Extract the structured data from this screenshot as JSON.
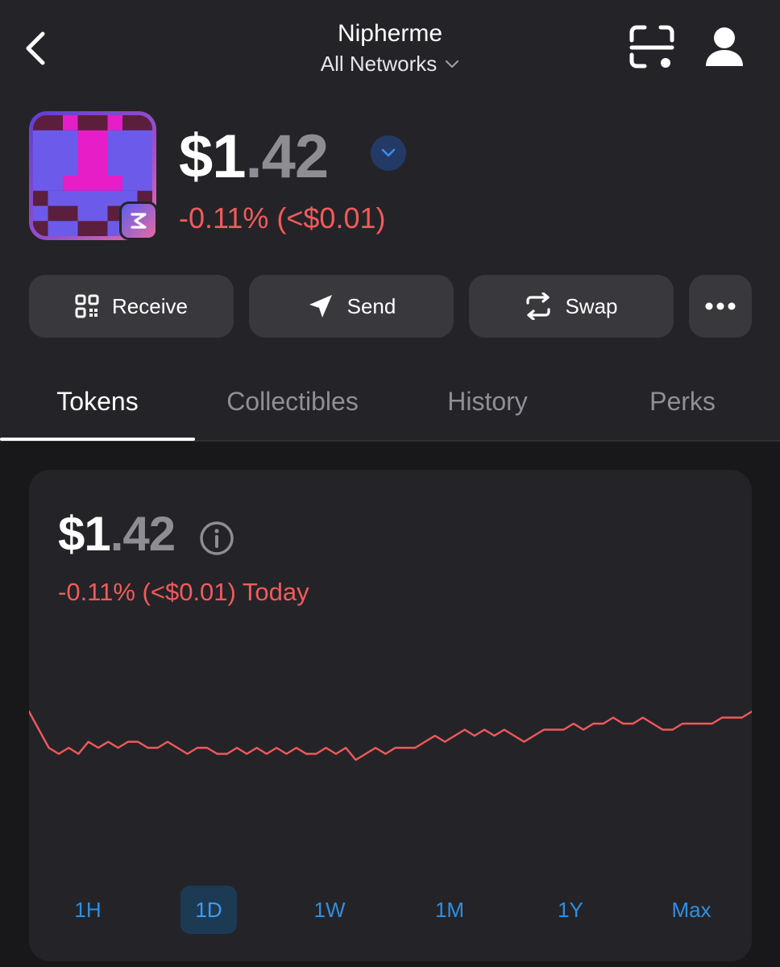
{
  "header": {
    "wallet_name": "Nipherme",
    "network_label": "All Networks"
  },
  "token": {
    "balance_main": "$1",
    "balance_cents": ".42",
    "change_text": "-0.11% (<$0.01)"
  },
  "actions": {
    "receive_label": "Receive",
    "send_label": "Send",
    "swap_label": "Swap"
  },
  "tabs": [
    {
      "label": "Tokens",
      "active": true
    },
    {
      "label": "Collectibles",
      "active": false
    },
    {
      "label": "History",
      "active": false
    },
    {
      "label": "Perks",
      "active": false
    }
  ],
  "card": {
    "balance_main": "$1",
    "balance_cents": ".42",
    "change_text": "-0.11% (<$0.01) Today"
  },
  "ranges": [
    {
      "label": "1H",
      "active": false
    },
    {
      "label": "1D",
      "active": true
    },
    {
      "label": "1W",
      "active": false
    },
    {
      "label": "1M",
      "active": false
    },
    {
      "label": "1Y",
      "active": false
    },
    {
      "label": "Max",
      "active": false
    }
  ],
  "chart_data": {
    "type": "line",
    "title": "",
    "xlabel": "",
    "ylabel": "",
    "color": "#f05a5a",
    "series": [
      {
        "values": [
          1.424,
          1.421,
          1.418,
          1.417,
          1.418,
          1.417,
          1.419,
          1.418,
          1.419,
          1.418,
          1.419,
          1.419,
          1.418,
          1.418,
          1.419,
          1.418,
          1.417,
          1.418,
          1.418,
          1.417,
          1.417,
          1.418,
          1.417,
          1.418,
          1.417,
          1.418,
          1.417,
          1.418,
          1.417,
          1.417,
          1.418,
          1.417,
          1.418,
          1.416,
          1.417,
          1.418,
          1.417,
          1.418,
          1.418,
          1.418,
          1.419,
          1.42,
          1.419,
          1.42,
          1.421,
          1.42,
          1.421,
          1.42,
          1.421,
          1.42,
          1.419,
          1.42,
          1.421,
          1.421,
          1.421,
          1.422,
          1.421,
          1.422,
          1.422,
          1.423,
          1.422,
          1.422,
          1.423,
          1.422,
          1.421,
          1.421,
          1.422,
          1.422,
          1.422,
          1.422,
          1.423,
          1.423,
          1.423,
          1.424
        ]
      }
    ],
    "grid": false,
    "legend": "none"
  },
  "colors": {
    "negative": "#f25b5b",
    "accent_blue": "#2f8fe0"
  },
  "icons": {
    "back": "chevron-left-icon",
    "network_dropdown": "chevron-down-icon",
    "scan": "scan-icon",
    "profile": "user-icon",
    "receive": "qr-code-icon",
    "send": "send-icon",
    "swap": "swap-icon",
    "more": "more-dots-icon",
    "info": "info-icon"
  }
}
